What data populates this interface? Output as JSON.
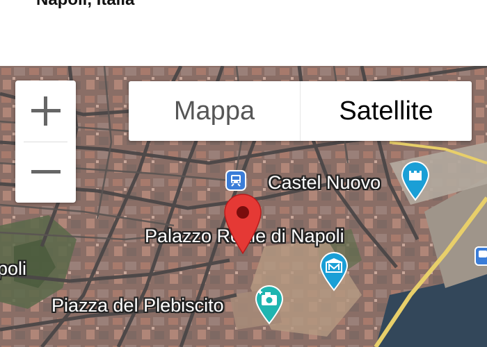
{
  "header": {
    "address": "Napoli, Italia"
  },
  "zoom": {
    "in_label": "+",
    "out_label": "−",
    "in_icon": "plus-icon",
    "out_icon": "minus-icon"
  },
  "map_type": {
    "options": [
      "Mappa",
      "Satellite"
    ],
    "selected": "Satellite"
  },
  "places": [
    {
      "name": "Castel Nuovo",
      "icon": "castle-icon",
      "color": "#1a9fd6"
    },
    {
      "name": "Palazzo Reale di Napoli",
      "icon": "museum-icon",
      "color": "#1a9fd6"
    },
    {
      "name": "Piazza del Plebiscito",
      "icon": "camera-icon",
      "color": "#1fb5b0"
    },
    {
      "name": "poli",
      "icon": null
    }
  ],
  "transit": {
    "icon": "train-station-icon",
    "color": "#3b7dd8"
  },
  "marker": {
    "icon": "location-pin-icon",
    "color": "#e53935"
  }
}
